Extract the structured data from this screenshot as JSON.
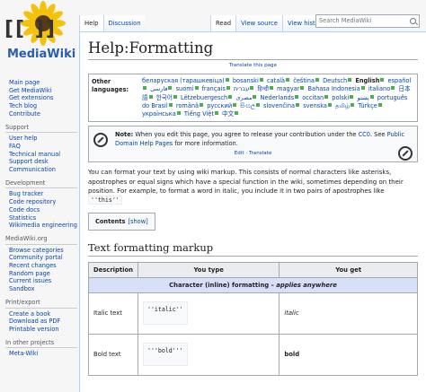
{
  "logo": {
    "brackets": "[[ ]]",
    "text": "MediaWiki"
  },
  "tabs_left": [
    "Help",
    "Discussion"
  ],
  "tabs_right": [
    "Read",
    "View source",
    "View history"
  ],
  "search": {
    "placeholder": "Search MediaWiki"
  },
  "sidebar": [
    {
      "head": "",
      "items": [
        "Main page",
        "Get MediaWiki",
        "Get extensions",
        "Tech blog",
        "Contribute"
      ]
    },
    {
      "head": "Support",
      "items": [
        "User help",
        "FAQ",
        "Technical manual",
        "Support desk",
        "Communication"
      ]
    },
    {
      "head": "Development",
      "items": [
        "Bug tracker",
        "Code repository",
        "Code docs",
        "Statistics",
        "Wikimedia engineering"
      ]
    },
    {
      "head": "MediaWiki.org",
      "items": [
        "Browse categories",
        "Community portal",
        "Recent changes",
        "Random page",
        "Current issues",
        "Sandbox"
      ]
    },
    {
      "head": "Print/export",
      "items": [
        "Create a book",
        "Download as PDF",
        "Printable version"
      ]
    },
    {
      "head": "In other projects",
      "items": [
        "Meta-Wiki"
      ]
    }
  ],
  "page": {
    "title": "Help:Formatting",
    "translate_link": "Translate this page",
    "other_languages_label": "Other languages:",
    "languages": [
      {
        "name": "беларуская (тарашкевіца)",
        "st": "g"
      },
      {
        "name": "bosanski",
        "st": "g"
      },
      {
        "name": "català",
        "st": "g"
      },
      {
        "name": "čeština",
        "st": "g"
      },
      {
        "name": "Deutsch",
        "st": "g"
      },
      {
        "name": "English",
        "st": "g",
        "bold": true
      },
      {
        "name": "español",
        "st": "g"
      },
      {
        "name": "فارسی",
        "st": "g"
      },
      {
        "name": "suomi",
        "st": "g"
      },
      {
        "name": "français",
        "st": "g"
      },
      {
        "name": "עברית",
        "st": "g"
      },
      {
        "name": "हिन्दी",
        "st": "g"
      },
      {
        "name": "magyar",
        "st": "g"
      },
      {
        "name": "Bahasa Indonesia",
        "st": "g"
      },
      {
        "name": "italiano",
        "st": "g"
      },
      {
        "name": "日本語",
        "st": "g"
      },
      {
        "name": "한국어",
        "st": "g"
      },
      {
        "name": "Lëtzebuergesch",
        "st": "g"
      },
      {
        "name": "مصرى",
        "st": "g"
      },
      {
        "name": "Nederlands",
        "st": "g"
      },
      {
        "name": "occitan",
        "st": "g"
      },
      {
        "name": "polski",
        "st": "g"
      },
      {
        "name": "پښتو",
        "st": "g"
      },
      {
        "name": "português do Brasil",
        "st": "g"
      },
      {
        "name": "română",
        "st": "g"
      },
      {
        "name": "русский",
        "st": "g"
      },
      {
        "name": "සිංහල",
        "st": "g"
      },
      {
        "name": "slovenčina",
        "st": "g"
      },
      {
        "name": "svenska",
        "st": "g"
      },
      {
        "name": "தமிழ்",
        "st": "g"
      },
      {
        "name": "Türkçe",
        "st": "g"
      },
      {
        "name": "українська",
        "st": "g"
      },
      {
        "name": "Tiếng Việt",
        "st": "g"
      },
      {
        "name": "中文",
        "st": "g"
      }
    ],
    "note": {
      "label": "Note:",
      "text1": " When you edit this page, you agree to release your contribution under the ",
      "license_link": "CC0",
      "text2": ". See ",
      "pd_link": "Public Domain Help Pages",
      "text3": " for more information.",
      "edit_link": "Edit",
      "separator": " · ",
      "translate_link": "Translate"
    },
    "intro_1": "You can format your text by using wiki markup. This consists of normal characters like asterisks, apostrophes or equal signs which have a special function in the wiki, sometimes depending on their position. For example, to format a word in italic, you include it in two pairs of apostrophes like ",
    "intro_code": "''this''",
    "toc": {
      "label": "Contents",
      "show": "[show]"
    },
    "section_heading": "Text formatting markup",
    "table": {
      "headers": [
        "Description",
        "You type",
        "You get"
      ],
      "subhead_main": "Character (inline) formatting",
      "subhead_dash": " – ",
      "subhead_tail": "applies anywhere",
      "rows": [
        {
          "desc": "Italic text",
          "type": "''italic''",
          "get": "italic"
        },
        {
          "desc": "Bold text",
          "type": "'''bold'''",
          "get": "bold"
        }
      ]
    }
  }
}
